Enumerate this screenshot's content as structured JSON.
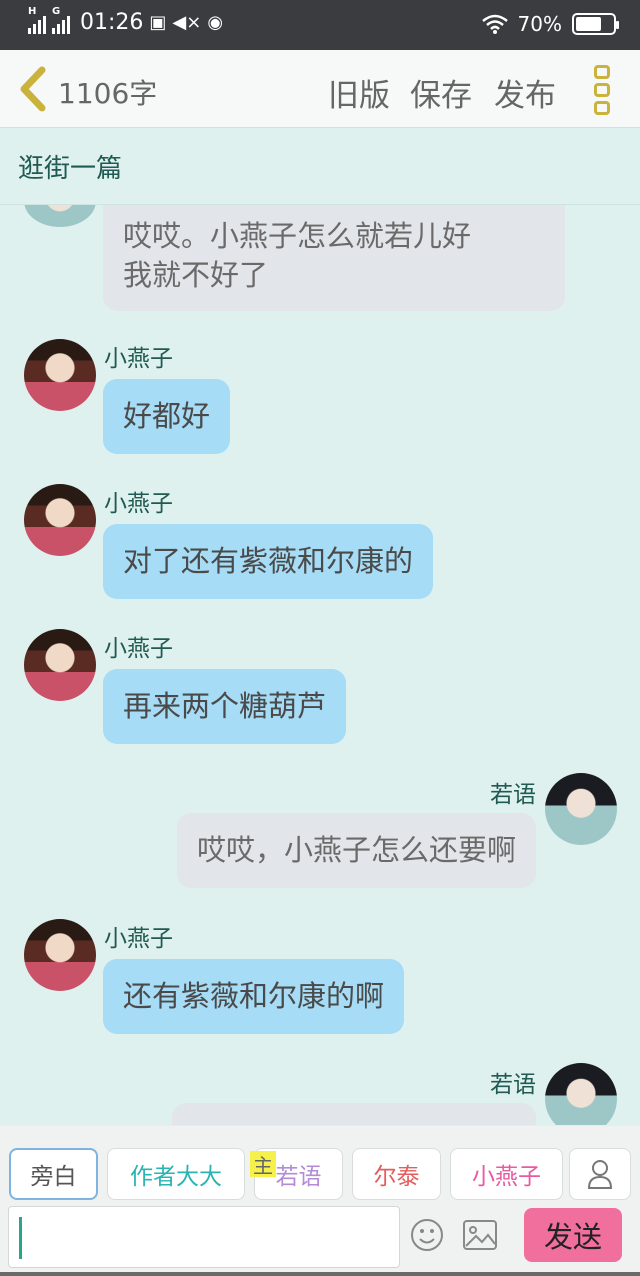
{
  "status": {
    "network_left": "H",
    "network_right": "G",
    "time": "01:26",
    "battery": "70%",
    "battery_level": 0.7
  },
  "header": {
    "word_count": "1106字",
    "old_version": "旧版",
    "save": "保存",
    "publish": "发布"
  },
  "doc_title": "逛街一篇",
  "messages": [
    {
      "speaker": "",
      "side": "left",
      "text": "哎哎。小燕子怎么就若儿好\n我就不好了",
      "style": "gray"
    },
    {
      "speaker": "小燕子",
      "side": "left",
      "text": "好都好",
      "style": "blue"
    },
    {
      "speaker": "小燕子",
      "side": "left",
      "text": "对了还有紫薇和尔康的",
      "style": "blue"
    },
    {
      "speaker": "小燕子",
      "side": "left",
      "text": "再来两个糖葫芦",
      "style": "blue"
    },
    {
      "speaker": "若语",
      "side": "right",
      "text": "哎哎，小燕子怎么还要啊",
      "style": "gray"
    },
    {
      "speaker": "小燕子",
      "side": "left",
      "text": "还有紫薇和尔康的啊",
      "style": "blue"
    },
    {
      "speaker": "若语",
      "side": "right",
      "text": "",
      "style": "gray"
    }
  ],
  "roles": {
    "narration": "旁白",
    "author": "作者大大",
    "main_tag": "主",
    "ruoyu": "若语",
    "ertai": "尔泰",
    "xiaoyanzi": "小燕子"
  },
  "icons": {
    "back": "chevron-left-icon",
    "menu": "more-vertical-icon",
    "add_role": "person-icon",
    "emoji": "smiley-icon",
    "image": "image-icon"
  },
  "input": {
    "value": "",
    "send": "发送"
  },
  "colors": {
    "background": "#dff1ef",
    "bubble_blue": "#a6dcf5",
    "bubble_gray": "#e2e6ea",
    "send_button": "#f06f9c",
    "accent_green": "#205a52"
  }
}
